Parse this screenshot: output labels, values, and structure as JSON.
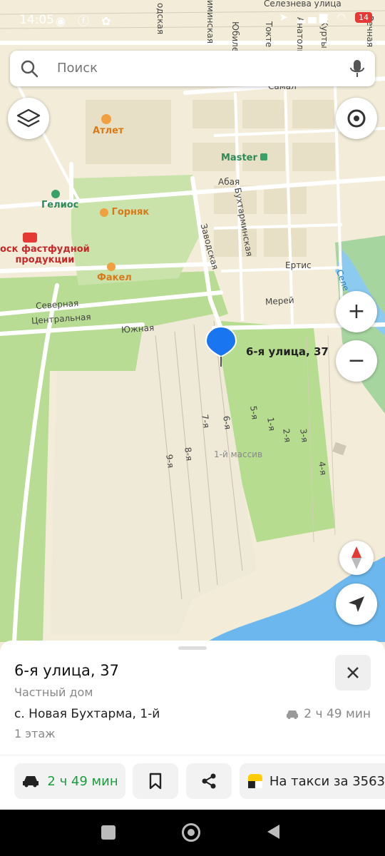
{
  "status": {
    "time": "14:05",
    "battery": "14"
  },
  "search": {
    "placeholder": "Поиск"
  },
  "map": {
    "pois": {
      "atlet": "Атлет",
      "master": "Master",
      "gelios": "Гелиос",
      "gornyak": "Горняк",
      "fastfood": "оск фастфудной\nпродукции",
      "fakel": "Факел"
    },
    "streets": {
      "selezneva": "Селезнева улица",
      "tokt": "Токте",
      "yubil": "Юбилейн",
      "anatoliya": "Анатолия К",
      "kurt": "Курты",
      "rech": "Речная",
      "kalin": "иминская",
      "odsk": "одская",
      "samal": "Самал",
      "abaya": "Абая",
      "bukhtarminskaya": "Бухтарминская",
      "zavodskaya": "Заводская",
      "ertis": "Ертис",
      "merey": "Мерей",
      "severnaya": "Северная",
      "tsentralnaya": "Центральная",
      "yuzhnaya": "Южная",
      "s5": "5-я",
      "s1": "1-я",
      "s2": "2-я",
      "s3": "3-я",
      "s4": "4-я",
      "s6": "6-я",
      "s7": "7-я",
      "s8": "8-я",
      "s9": "9-я",
      "massiv": "1-й массив",
      "sele": "Селе"
    },
    "pin_label": "6-я улица, 37"
  },
  "card": {
    "title": "6-я улица, 37",
    "type": "Частный дом",
    "address": "с. Новая Бухтарма, 1-й",
    "drive_time": "2 ч 49 мин",
    "floor": "1 этаж"
  },
  "actions": {
    "route_time": "2 ч 49 мин",
    "taxi": "На такси за 3563"
  },
  "colors": {
    "route_green": "#1a9c3e",
    "pin_blue": "#1976f0"
  }
}
